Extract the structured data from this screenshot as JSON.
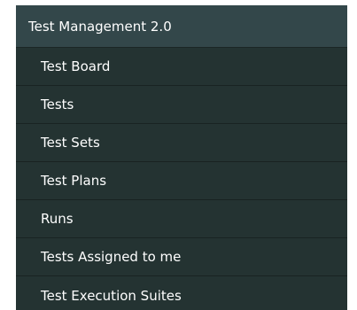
{
  "menu": {
    "title": "Test Management 2.0",
    "items": [
      {
        "label": "Test Board"
      },
      {
        "label": "Tests"
      },
      {
        "label": "Test Sets"
      },
      {
        "label": "Test Plans"
      },
      {
        "label": "Runs"
      },
      {
        "label": "Tests Assigned to me"
      },
      {
        "label": "Test Execution Suites"
      }
    ]
  },
  "colors": {
    "header_bg": "#33474a",
    "menu_bg": "#243332",
    "text": "#ffffff"
  }
}
